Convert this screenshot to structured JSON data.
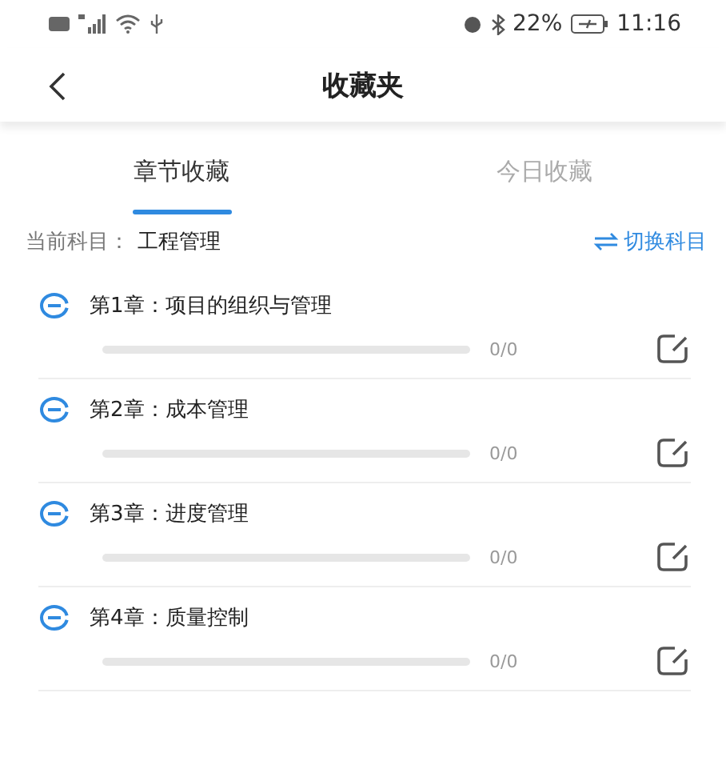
{
  "status_bar": {
    "battery": "22%",
    "time": "11:16"
  },
  "header": {
    "title": "收藏夹"
  },
  "tabs": [
    {
      "label": "章节收藏",
      "selected": true
    },
    {
      "label": "今日收藏",
      "selected": false
    }
  ],
  "subject": {
    "label": "当前科目：",
    "value": "工程管理",
    "switch": "切换科目"
  },
  "chapters": [
    {
      "title": "第1章：项目的组织与管理",
      "count": "0/0"
    },
    {
      "title": "第2章：成本管理",
      "count": "0/0"
    },
    {
      "title": "第3章：进度管理",
      "count": "0/0"
    },
    {
      "title": "第4章：质量控制",
      "count": "0/0"
    }
  ]
}
